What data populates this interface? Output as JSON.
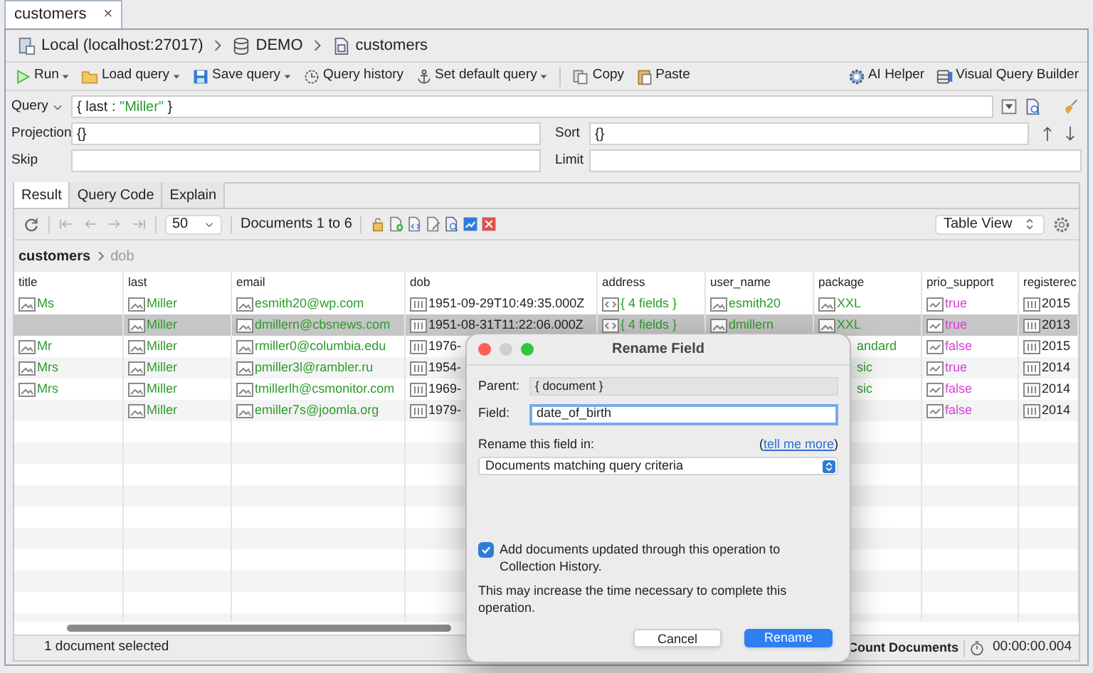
{
  "tab": {
    "label": "customers",
    "close": "×"
  },
  "breadcrumb": [
    {
      "label": "Local (localhost:27017)",
      "kind": "server"
    },
    {
      "label": "DEMO",
      "kind": "database"
    },
    {
      "label": "customers",
      "kind": "collection"
    }
  ],
  "toolbar": {
    "groups": [
      [
        {
          "label": "Run",
          "kind": "run",
          "menu": true
        },
        {
          "label": "Load query",
          "kind": "folder",
          "menu": true
        },
        {
          "label": "Save query",
          "kind": "save",
          "menu": true
        },
        {
          "label": "Query history",
          "kind": "history",
          "menu": false
        },
        {
          "label": "Set default query",
          "kind": "anchor",
          "menu": true
        }
      ],
      [
        {
          "label": "Copy",
          "kind": "copy",
          "menu": false
        },
        {
          "label": "Paste",
          "kind": "paste",
          "menu": false
        }
      ]
    ],
    "right": [
      {
        "label": "AI Helper",
        "kind": "ai"
      },
      {
        "label": "Visual Query Builder",
        "kind": "builder"
      }
    ]
  },
  "query": {
    "label": "Query",
    "tokens": [
      {
        "text": "{ last : ",
        "kind": "plain"
      },
      {
        "text": "\"Miller\"",
        "kind": "string"
      },
      {
        "text": " }",
        "kind": "plain"
      }
    ]
  },
  "projection": {
    "label": "Projection",
    "value": "{}"
  },
  "sort": {
    "label": "Sort",
    "value": "{}"
  },
  "skip": {
    "label": "Skip"
  },
  "limit": {
    "label": "Limit"
  },
  "result_tabs": [
    {
      "label": "Result",
      "selected": true
    },
    {
      "label": "Query Code",
      "selected": false
    },
    {
      "label": "Explain",
      "selected": false
    }
  ],
  "result_toolbar": {
    "page_size": "50",
    "range": "Documents 1 to 6",
    "view": "Table View"
  },
  "path": {
    "collection": "customers",
    "field": "dob"
  },
  "table": {
    "columns": [
      "title",
      "last",
      "email",
      "dob",
      "address",
      "user_name",
      "package",
      "prio_support",
      "registerec"
    ],
    "rows": [
      {
        "selected": false,
        "cells": [
          {
            "text": "Ms",
            "kind": "string"
          },
          {
            "text": "Miller",
            "kind": "string"
          },
          {
            "text": "esmith20@wp.com",
            "kind": "string"
          },
          {
            "text": "1951-09-29T10:49:35.000Z",
            "kind": "date"
          },
          {
            "text": "{ 4 fields }",
            "kind": "object"
          },
          {
            "text": "esmith20",
            "kind": "string"
          },
          {
            "text": "XXL",
            "kind": "string"
          },
          {
            "text": "true",
            "kind": "bool"
          },
          {
            "text": "2015",
            "kind": "date"
          }
        ]
      },
      {
        "selected": true,
        "cells": [
          null,
          {
            "text": "Miller",
            "kind": "string"
          },
          {
            "text": "dmillern@cbsnews.com",
            "kind": "string"
          },
          {
            "text": "1951-08-31T11:22:06.000Z",
            "kind": "date"
          },
          {
            "text": "{ 4 fields }",
            "kind": "object"
          },
          {
            "text": "dmillern",
            "kind": "string"
          },
          {
            "text": "XXL",
            "kind": "string"
          },
          {
            "text": "true",
            "kind": "bool"
          },
          {
            "text": "2013",
            "kind": "date"
          }
        ]
      },
      {
        "selected": false,
        "cells": [
          {
            "text": "Mr",
            "kind": "string"
          },
          {
            "text": "Miller",
            "kind": "string"
          },
          {
            "text": "rmiller0@columbia.edu",
            "kind": "string"
          },
          {
            "text": "1976-",
            "kind": "date"
          },
          null,
          null,
          {
            "text": "andard",
            "kind": "string",
            "covered": true
          },
          {
            "text": "false",
            "kind": "bool"
          },
          {
            "text": "2015",
            "kind": "date"
          }
        ]
      },
      {
        "selected": false,
        "cells": [
          {
            "text": "Mrs",
            "kind": "string"
          },
          {
            "text": "Miller",
            "kind": "string"
          },
          {
            "text": "pmiller3l@rambler.ru",
            "kind": "string"
          },
          {
            "text": "1954-",
            "kind": "date"
          },
          null,
          null,
          {
            "text": "sic",
            "kind": "string",
            "covered": true
          },
          {
            "text": "true",
            "kind": "bool"
          },
          {
            "text": "2014",
            "kind": "date"
          }
        ]
      },
      {
        "selected": false,
        "cells": [
          {
            "text": "Mrs",
            "kind": "string"
          },
          {
            "text": "Miller",
            "kind": "string"
          },
          {
            "text": "tmillerlh@csmonitor.com",
            "kind": "string"
          },
          {
            "text": "1969-",
            "kind": "date"
          },
          null,
          null,
          {
            "text": "sic",
            "kind": "string",
            "covered": true
          },
          {
            "text": "false",
            "kind": "bool"
          },
          {
            "text": "2014",
            "kind": "date"
          }
        ]
      },
      {
        "selected": false,
        "cells": [
          null,
          {
            "text": "Miller",
            "kind": "string"
          },
          {
            "text": "emiller7s@joomla.org",
            "kind": "string"
          },
          {
            "text": "1979-",
            "kind": "date"
          },
          null,
          null,
          null,
          {
            "text": "false",
            "kind": "bool"
          },
          {
            "text": "2014",
            "kind": "date"
          }
        ]
      }
    ]
  },
  "status": {
    "selection": "1 document selected",
    "count_button": "Count Documents",
    "elapsed": "00:00:00.004"
  },
  "dialog": {
    "title": "Rename Field",
    "parent_label": "Parent:",
    "parent_value": "{ document }",
    "field_label": "Field:",
    "field_value": "date_of_birth",
    "scope_label": "Rename this field in:",
    "link_prefix": "(",
    "link": "tell me more",
    "link_suffix": ")",
    "scope_value": "Documents matching query criteria",
    "history": {
      "label": "Add documents updated through this operation to Collection History.",
      "checked": true
    },
    "note": "This may increase the time necessary to complete this operation.",
    "buttons": [
      {
        "label": "Cancel",
        "kind": "secondary"
      },
      {
        "label": "Rename",
        "kind": "primary"
      }
    ]
  }
}
